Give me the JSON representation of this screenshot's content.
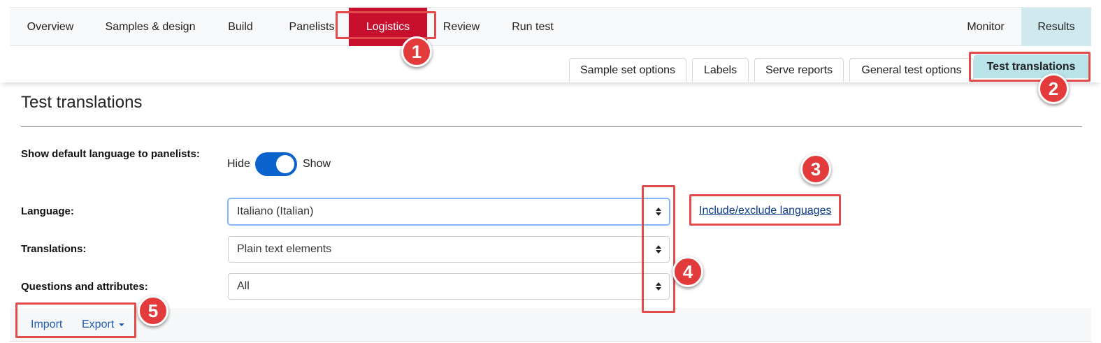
{
  "nav": {
    "items": [
      "Overview",
      "Samples & design",
      "Build",
      "Panelists",
      "Logistics",
      "Review",
      "Run test"
    ],
    "right": [
      "Monitor",
      "Results"
    ],
    "active": "Logistics"
  },
  "subtabs": {
    "items": [
      "Sample set options",
      "Labels",
      "Serve reports",
      "General test options",
      "Test translations"
    ],
    "active": "Test translations"
  },
  "page": {
    "title": "Test translations"
  },
  "form": {
    "show_default_label": "Show default language to panelists:",
    "toggle_off": "Hide",
    "toggle_on": "Show",
    "toggle_state": "on",
    "language_label": "Language:",
    "language_value": "Italiano (Italian)",
    "translations_label": "Translations:",
    "translations_value": "Plain text elements",
    "questions_label": "Questions and attributes:",
    "questions_value": "All",
    "include_link": "Include/exclude languages"
  },
  "toolbar": {
    "import": "Import",
    "export": "Export"
  },
  "annotations": [
    "1",
    "2",
    "3",
    "4",
    "5"
  ],
  "colors": {
    "active_nav": "#c8102e",
    "results_bg": "#cfe9ee",
    "active_subtab": "#b9e3e8",
    "toggle": "#0b63ce",
    "callout": "#e34b4b"
  }
}
